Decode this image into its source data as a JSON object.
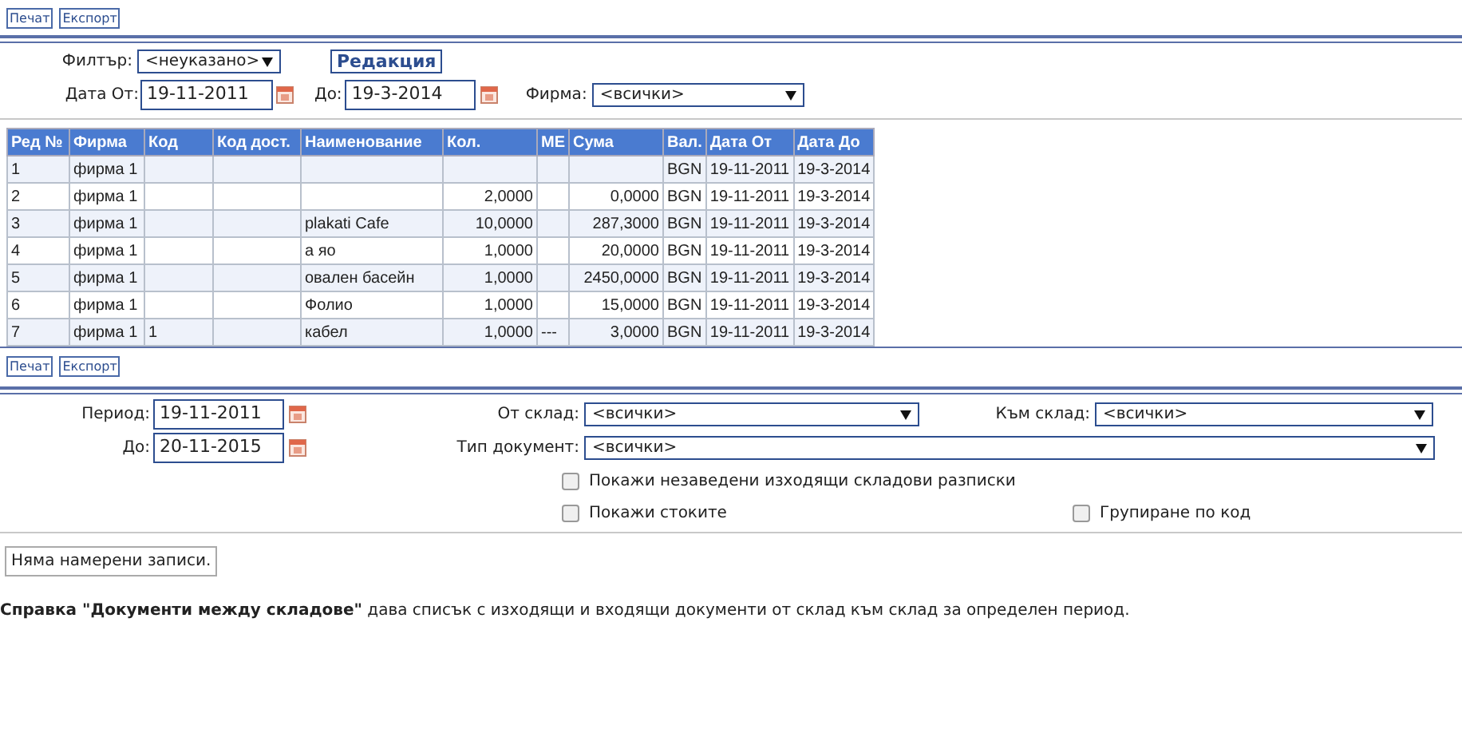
{
  "top_toolbar": [
    "Печат",
    "Експорт"
  ],
  "filter": {
    "filter_label": "Филтър:",
    "filter_value": "<неуказано>",
    "edit_button": "Редакция",
    "date_from_label": "Дата От:",
    "date_from": "19-11-2011",
    "date_to_label": "До:",
    "date_to": "19-3-2014",
    "firm_label": "Фирма:",
    "firm_value": "<всички>"
  },
  "table": {
    "columns": [
      "Ред №",
      "Фирма",
      "Код",
      "Код дост.",
      "Наименование",
      "Кол.",
      "МЕ",
      "Сума",
      "Вал.",
      "Дата От",
      "Дата До"
    ],
    "rows": [
      [
        "1",
        "фирма 1",
        "",
        "",
        "",
        "",
        "",
        "",
        "BGN",
        "19-11-2011",
        "19-3-2014"
      ],
      [
        "2",
        "фирма 1",
        "",
        "",
        "",
        "2,0000",
        "",
        "0,0000",
        "BGN",
        "19-11-2011",
        "19-3-2014"
      ],
      [
        "3",
        "фирма 1",
        "",
        "",
        "plakati Cafe",
        "10,0000",
        "",
        "287,3000",
        "BGN",
        "19-11-2011",
        "19-3-2014"
      ],
      [
        "4",
        "фирма 1",
        "",
        "",
        "а яо",
        "1,0000",
        "",
        "20,0000",
        "BGN",
        "19-11-2011",
        "19-3-2014"
      ],
      [
        "5",
        "фирма 1",
        "",
        "",
        "овален басейн",
        "1,0000",
        "",
        "2450,0000",
        "BGN",
        "19-11-2011",
        "19-3-2014"
      ],
      [
        "6",
        "фирма 1",
        "",
        "",
        "Фолио",
        "1,0000",
        "",
        "15,0000",
        "BGN",
        "19-11-2011",
        "19-3-2014"
      ],
      [
        "7",
        "фирма 1",
        "1",
        "",
        "кабел",
        "1,0000",
        "---",
        "3,0000",
        "BGN",
        "19-11-2011",
        "19-3-2014"
      ]
    ]
  },
  "bottom_toolbar": [
    "Печат",
    "Експорт"
  ],
  "report_form": {
    "period_label": "Период:",
    "period_from": "19-11-2011",
    "period_to_label": "До:",
    "period_to": "20-11-2015",
    "from_store_label": "От склад:",
    "from_store": "<всички>",
    "to_store_label": "Към склад:",
    "to_store": "<всички>",
    "doc_type_label": "Тип документ:",
    "doc_type": "<всички>",
    "checkboxes": [
      {
        "label": "Покажи незаведени изходящи складови разписки",
        "checked": false
      },
      {
        "label": "Покажи стоките",
        "checked": false
      },
      {
        "label": "Групиране по код",
        "checked": false
      }
    ]
  },
  "message": "Няма намерени записи.",
  "description": "**Справка \"Документи между складове\"** дава списък с изходящи и входящи документи от склад към склад за определен период."
}
